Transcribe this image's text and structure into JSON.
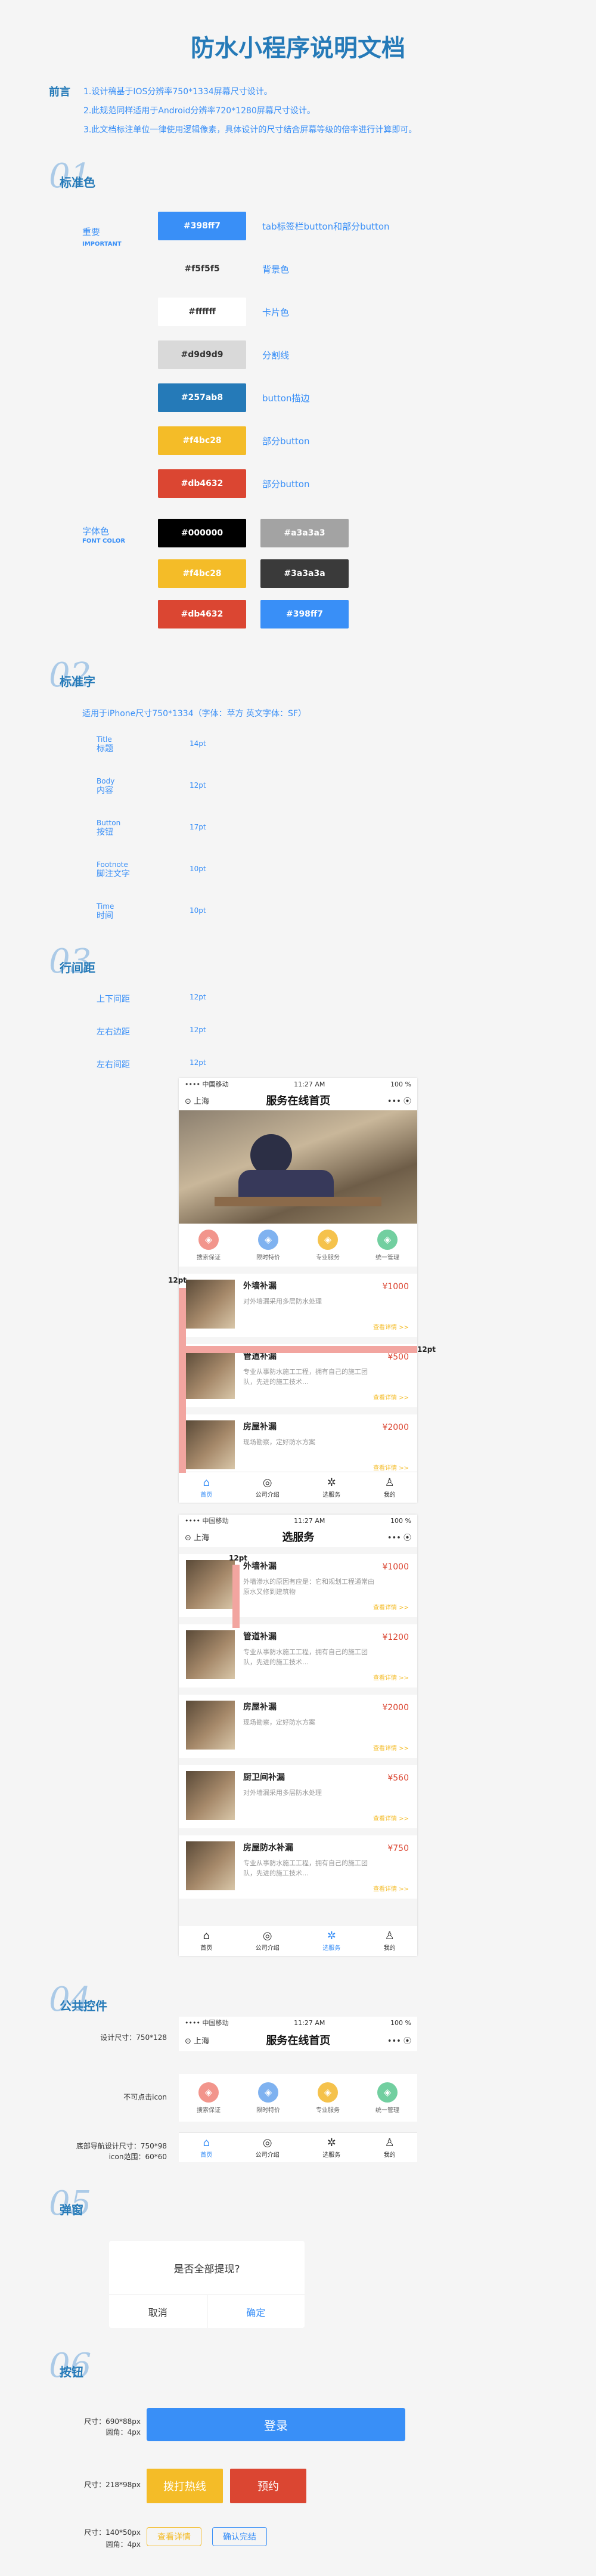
{
  "title": "防水小程序说明文档",
  "preface": {
    "label": "前言",
    "lines": [
      "1.设计稿基于IOS分辨率750*1334屏幕尺寸设计。",
      "2.此规范同样适用于Android分辨率720*1280屏幕尺寸设计。",
      "3.此文档标注单位一律使用逻辑像素，具体设计的尺寸结合屏幕等级的倍率进行计算即可。"
    ]
  },
  "sections": {
    "s1": {
      "num": "01",
      "title": "标准色"
    },
    "s2": {
      "num": "02",
      "title": "标准字"
    },
    "s3": {
      "num": "03",
      "title": "行间距"
    },
    "s4": {
      "num": "04",
      "title": "公共控件"
    },
    "s5": {
      "num": "05",
      "title": "弹窗"
    },
    "s6": {
      "num": "06",
      "title": "按钮"
    }
  },
  "colors": {
    "important_label": "重要",
    "important_sub": "IMPORTANT",
    "swatches": [
      {
        "hex": "#398ff7",
        "desc": "tab标签栏button和部分button",
        "bg": "#398ff7",
        "fg": "#ffffff"
      },
      {
        "hex": "#f5f5f5",
        "desc": "背景色",
        "bg": "#f5f5f5",
        "fg": "#333333"
      },
      {
        "hex": "#ffffff",
        "desc": "卡片色",
        "bg": "#ffffff",
        "fg": "#333333"
      },
      {
        "hex": "#d9d9d9",
        "desc": "分割线",
        "bg": "#d9d9d9",
        "fg": "#333333"
      },
      {
        "hex": "#257ab8",
        "desc": "button描边",
        "bg": "#257ab8",
        "fg": "#ffffff"
      },
      {
        "hex": "#f4bc28",
        "desc": "部分button",
        "bg": "#f4bc28",
        "fg": "#ffffff"
      },
      {
        "hex": "#db4632",
        "desc": "部分button",
        "bg": "#db4632",
        "fg": "#ffffff"
      }
    ],
    "font_label": "字体色",
    "font_sub": "FONT COLOR",
    "font_swatches": [
      {
        "hex": "#000000",
        "bg": "#000000"
      },
      {
        "hex": "#a3a3a3",
        "bg": "#a3a3a3"
      },
      {
        "hex": "#f4bc28",
        "bg": "#f4bc28"
      },
      {
        "hex": "#3a3a3a",
        "bg": "#3a3a3a"
      },
      {
        "hex": "#db4632",
        "bg": "#db4632"
      },
      {
        "hex": "#398ff7",
        "bg": "#398ff7"
      }
    ]
  },
  "typography": {
    "intro": "适用于iPhone尺寸750*1334（字体：苹方  英文字体：SF）",
    "rows": [
      {
        "en": "Title",
        "zh": "标题",
        "size": "14pt"
      },
      {
        "en": "Body",
        "zh": "内容",
        "size": "12pt"
      },
      {
        "en": "Button",
        "zh": "按钮",
        "size": "17pt"
      },
      {
        "en": "Footnote",
        "zh": "脚注文字",
        "size": "10pt"
      },
      {
        "en": "Time",
        "zh": "时间",
        "size": "10pt"
      }
    ]
  },
  "spacing": {
    "rows": [
      {
        "label": "上下间距",
        "value": "12pt"
      },
      {
        "label": "左右边距",
        "value": "12pt"
      },
      {
        "label": "左右间距",
        "value": "12pt"
      }
    ],
    "marker_left": "12pt",
    "marker_right": "12pt",
    "marker_top": "12pt"
  },
  "phone": {
    "status_carrier": "•••• 中国移动",
    "status_time": "11:27 AM",
    "status_battery": "100 %",
    "location": "上海",
    "home_title": "服务在线首页",
    "select_title": "选服务",
    "more_icon": "•••",
    "categories": [
      {
        "label": "搜索保证",
        "color": "#f2958c"
      },
      {
        "label": "限时特价",
        "color": "#7fb2f0"
      },
      {
        "label": "专业服务",
        "color": "#f5c24c"
      },
      {
        "label": "统一管理",
        "color": "#72cfa0"
      }
    ],
    "services": [
      {
        "name": "外墙补漏",
        "price": "¥1000",
        "desc": "对外墙漏采用多层防水处理",
        "link": "查看详情 >>"
      },
      {
        "name": "管道补漏",
        "price": "¥500",
        "desc": "专业从事防水施工工程，拥有自己的施工团队，先进的施工技术…",
        "link": "查看详情 >>"
      },
      {
        "name": "房屋补漏",
        "price": "¥2000",
        "desc": "现场勘察，定好防水方案",
        "link": "查看详情 >>"
      }
    ],
    "services2": [
      {
        "name": "外墙补漏",
        "price": "¥1000",
        "desc": "外墙渗水的原因有应是：它和规划工程通常由原水又修到建筑物",
        "link": "查看详情 >>"
      },
      {
        "name": "管道补漏",
        "price": "¥1200",
        "desc": "专业从事防水施工工程，拥有自己的施工团队，先进的施工技术…",
        "link": "查看详情 >>"
      },
      {
        "name": "房屋补漏",
        "price": "¥2000",
        "desc": "现场勘察，定好防水方案",
        "link": "查看详情 >>"
      },
      {
        "name": "厨卫间补漏",
        "price": "¥560",
        "desc": "对外墙漏采用多层防水处理",
        "link": "查看详情 >>"
      },
      {
        "name": "房屋防水补漏",
        "price": "¥750",
        "desc": "专业从事防水施工工程，拥有自己的施工团队，先进的施工技术…",
        "link": "查看详情 >>"
      }
    ],
    "tabs": [
      {
        "label": "首页",
        "icon": "⌂"
      },
      {
        "label": "公司介绍",
        "icon": "◎"
      },
      {
        "label": "选服务",
        "icon": "✲"
      },
      {
        "label": "我的",
        "icon": "♙"
      }
    ]
  },
  "controls": {
    "design_size": "设计尺寸：750*128",
    "not_clickable": "不可点击icon",
    "tabbar_size": "底部导航设计尺寸：750*98",
    "icon_range": "icon范围：60*60"
  },
  "dialog": {
    "message": "是否全部提现?",
    "cancel": "取消",
    "confirm": "确定"
  },
  "buttons": {
    "b1_size": "尺寸：690*88px",
    "b1_radius": "圆角：4px",
    "b1_label": "登录",
    "b2_size": "尺寸：218*98px",
    "b2_a": "拨打热线",
    "b2_b": "预约",
    "b3_size": "尺寸：140*50px",
    "b3_radius": "圆角：4px",
    "b3_a": "查看详情",
    "b3_b": "确认完结"
  }
}
